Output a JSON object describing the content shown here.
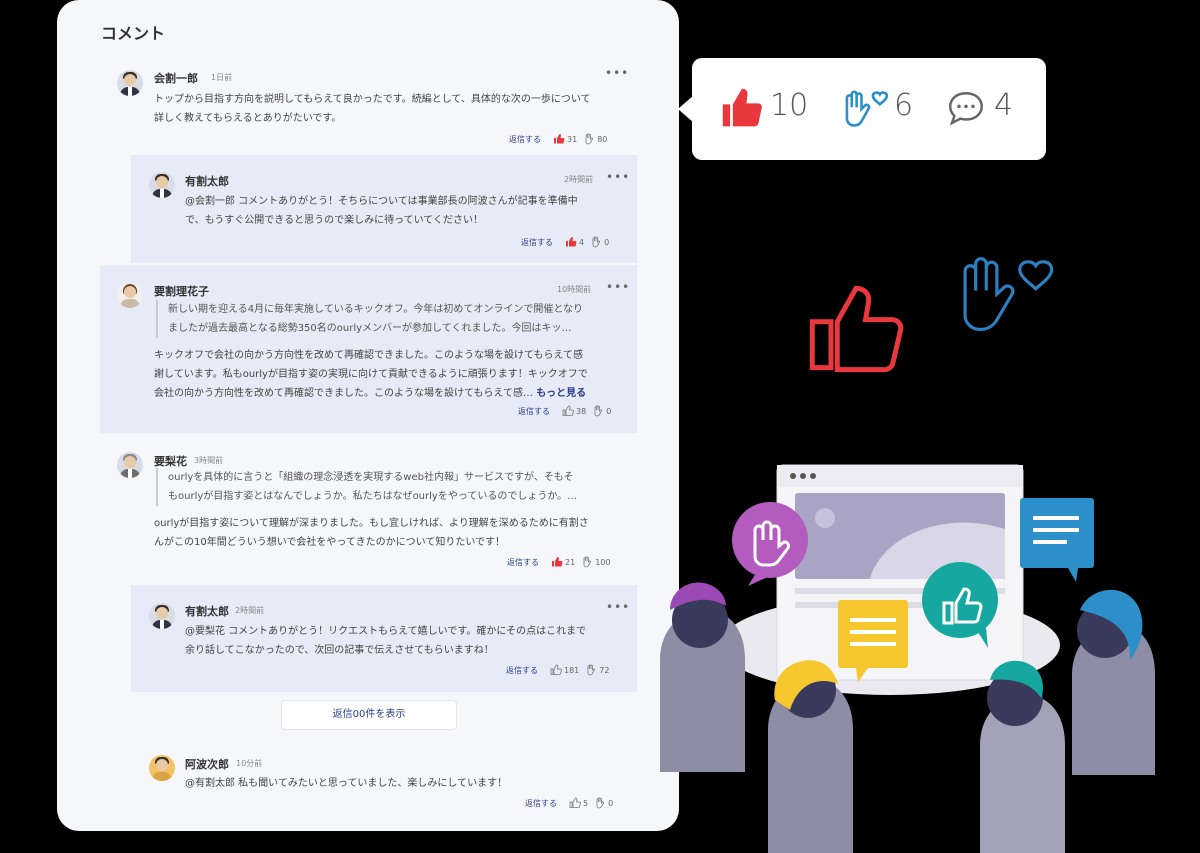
{
  "panel": {
    "title": "コメント",
    "show_replies_label": "返信00件を表示"
  },
  "comments": [
    {
      "name": "会割一郎",
      "time": "1日前",
      "text1": "トップから目指す方向を説明してもらえて良かったです。続編として、具体的な次の一歩について",
      "text2": "詳しく教えてもらえるとありがたいです。",
      "reply": "返信する",
      "likes": "31",
      "claps": "80"
    },
    {
      "name": "有割太郎",
      "time": "2時間前",
      "text1": "@会割一郎 コメントありがとう！そちらについては事業部長の阿波さんが記事を準備中",
      "text2": "で、もうすぐ公開できると思うので楽しみに待っていてください！",
      "reply": "返信する",
      "likes": "4",
      "claps": "0"
    },
    {
      "name": "要割理花子",
      "time": "10時間前",
      "quote1": "新しい期を迎える4月に毎年実施しているキックオフ。今年は初めてオンラインで開催となり",
      "quote2": "ましたが過去最高となる総勢350名のourlyメンバーが参加してくれました。今回はキッ…",
      "text1": "キックオフで会社の向かう方向性を改めて再確認できました。このような場を設けてもらえて感",
      "text2": "謝しています。私もourlyが目指す姿の実現に向けて貢献できるように頑張ります！キックオフで",
      "text3": "会社の向かう方向性を改めて再確認できました。このような場を設けてもらえて感…",
      "more": "もっと見る",
      "reply": "返信する",
      "likes": "38",
      "claps": "0"
    },
    {
      "name": "要梨花",
      "time": "3時間前",
      "quote1": "ourlyを具体的に言うと「組織の理念浸透を実現するweb社内報」サービスですが、そもそ",
      "quote2": "もourlyが目指す姿とはなんでしょうか。私たちはなぜourlyをやっているのでしょうか。…",
      "text1": "ourlyが目指す姿について理解が深まりました。もし宜しければ、より理解を深めるために有割さ",
      "text2": "んがこの10年間どういう想いで会社をやってきたのかについて知りたいです！",
      "reply": "返信する",
      "likes": "21",
      "claps": "100"
    },
    {
      "name": "有割太郎",
      "time": "2時間前",
      "text1": "@要梨花 コメントありがとう！リクエストもらえて嬉しいです。確かにその点はこれまで",
      "text2": "余り話してこなかったので、次回の記事で伝えさせてもらいますね！",
      "reply": "返信する",
      "likes": "181",
      "claps": "72"
    },
    {
      "name": "阿波次郎",
      "time": "10分前",
      "text1": "@有割太郎 私も聞いてみたいと思っていました、楽しみにしています！",
      "reply": "返信する",
      "likes": "5",
      "claps": "0"
    }
  ],
  "stats": {
    "likes": "10",
    "claps": "6",
    "comments": "4"
  },
  "colors": {
    "like_red": "#e8383d",
    "clap_blue": "#2d7fc1",
    "accent_navy": "#2a3e84",
    "reply_bg": "#e6ebf7"
  }
}
